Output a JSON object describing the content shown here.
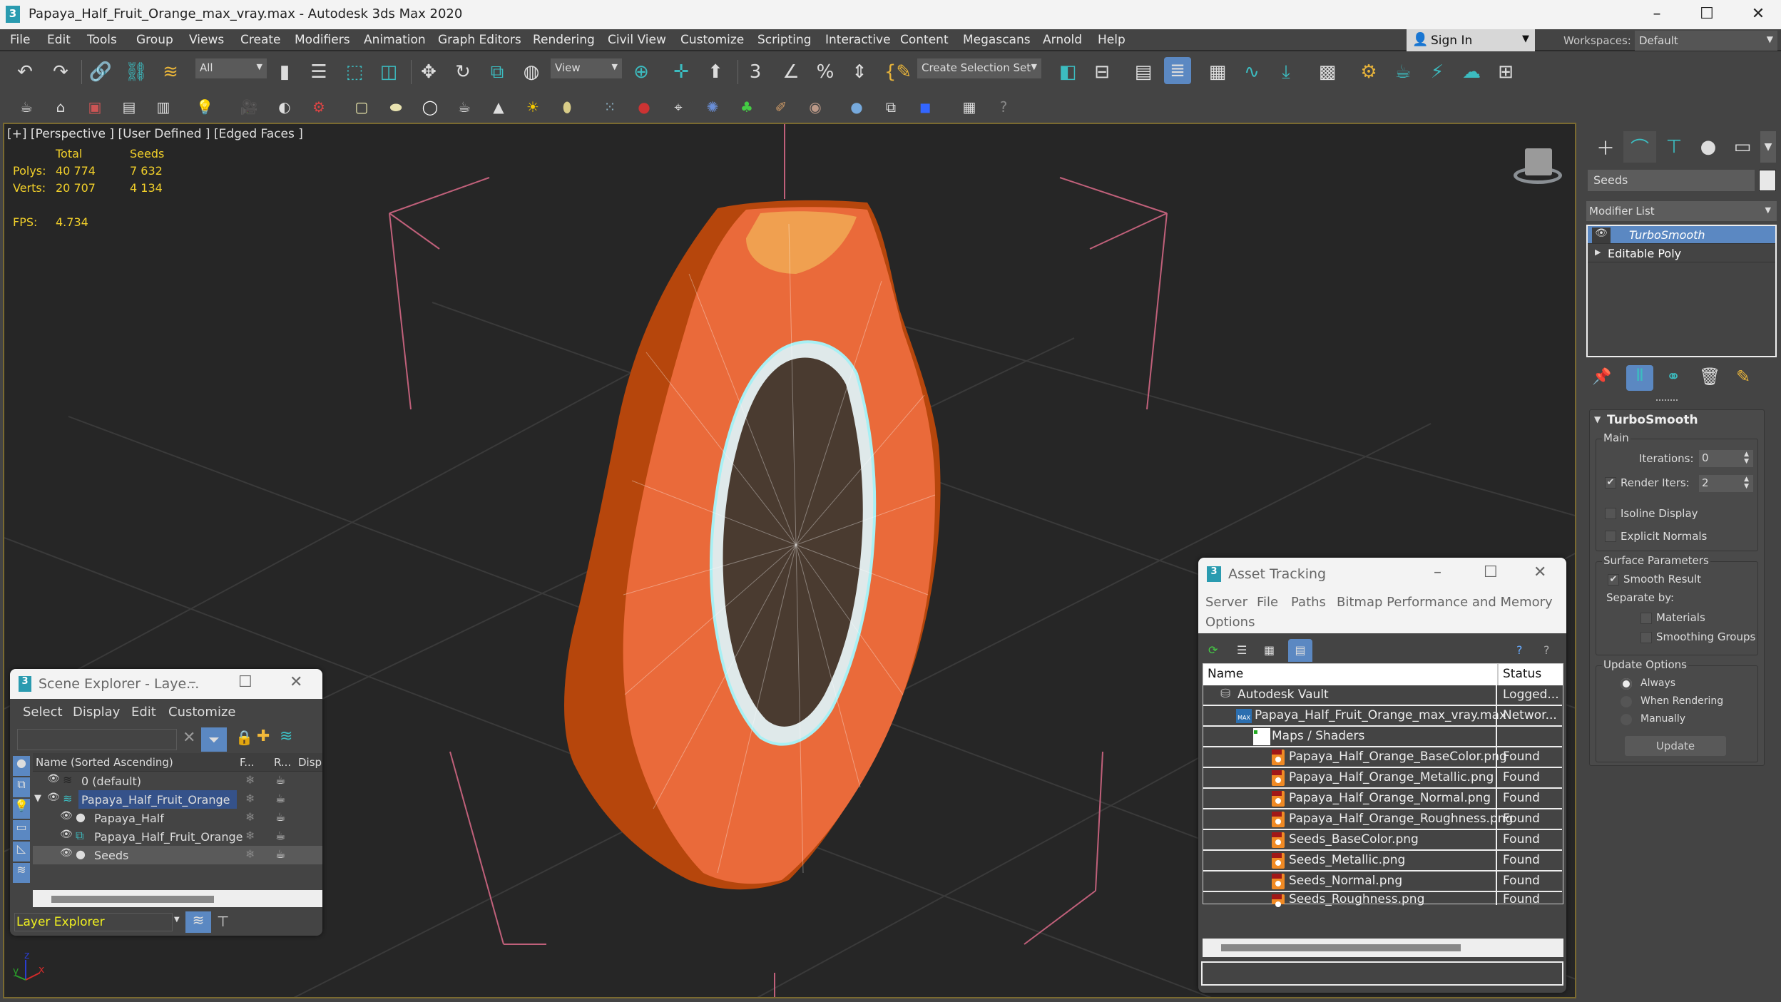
{
  "window": {
    "title": "Papaya_Half_Fruit_Orange_max_vray.max - Autodesk 3ds Max 2020",
    "app_icon": "3",
    "minimize_icon": "–",
    "maximize_icon": "☐",
    "close_icon": "✕"
  },
  "menubar": {
    "items": [
      "File",
      "Edit",
      "Tools",
      "Group",
      "Views",
      "Create",
      "Modifiers",
      "Animation",
      "Graph Editors",
      "Rendering",
      "Civil View",
      "Customize",
      "Scripting",
      "Interactive",
      "Content",
      "Megascans",
      "Arnold",
      "Help"
    ],
    "sign_in": "Sign In",
    "workspaces_label": "Workspaces:",
    "workspace_value": "Default"
  },
  "toolbar": {
    "selection_filter": "All",
    "reference_coord": "View",
    "selection_set": "Create Selection Set"
  },
  "viewport": {
    "label": "[+] [Perspective ] [User Defined ] [Edged Faces ]",
    "stats": {
      "col_total": "Total",
      "col_selected": "Seeds",
      "polys_label": "Polys:",
      "polys_total": "40 774",
      "polys_selected": "7 632",
      "verts_label": "Verts:",
      "verts_total": "20 707",
      "verts_selected": "4 134",
      "fps_label": "FPS:",
      "fps_value": "4.734"
    },
    "axis": {
      "x": "x",
      "y": "y",
      "z": "z"
    }
  },
  "command_panel": {
    "object_name": "Seeds",
    "modifier_list": "Modifier List",
    "stack": [
      {
        "label": "TurboSmooth",
        "selected": true
      },
      {
        "label": "Editable Poly",
        "selected": false
      }
    ],
    "turbosmooth": {
      "title": "TurboSmooth",
      "main_group": "Main",
      "iterations_label": "Iterations:",
      "iterations_value": "0",
      "render_iters_label": "Render Iters:",
      "render_iters_value": "2",
      "render_iters_checked": true,
      "isoline_label": "Isoline Display",
      "isoline_checked": false,
      "explicit_normals_label": "Explicit Normals",
      "explicit_normals_checked": false,
      "surface_group": "Surface Parameters",
      "smooth_result_label": "Smooth Result",
      "smooth_result_checked": true,
      "separate_by_label": "Separate by:",
      "materials_label": "Materials",
      "smoothing_groups_label": "Smoothing Groups",
      "update_group": "Update Options",
      "update_options": [
        "Always",
        "When Rendering",
        "Manually"
      ],
      "update_selected": "Always",
      "update_button": "Update"
    }
  },
  "scene_explorer": {
    "title": "Scene Explorer - Laye...",
    "menu": [
      "Select",
      "Display",
      "Edit",
      "Customize"
    ],
    "search_placeholder": "",
    "columns": [
      "Name (Sorted Ascending)",
      "F...",
      "R...",
      "Displ"
    ],
    "rows": [
      {
        "name": "0 (default)",
        "type": "layer",
        "level": 0
      },
      {
        "name": "Papaya_Half_Fruit_Orange",
        "type": "layer-active",
        "level": 0
      },
      {
        "name": "Papaya_Half",
        "type": "object",
        "level": 1
      },
      {
        "name": "Papaya_Half_Fruit_Orange",
        "type": "group",
        "level": 1
      },
      {
        "name": "Seeds",
        "type": "object",
        "level": 1
      }
    ],
    "explorer_type": "Layer Explorer"
  },
  "asset_tracking": {
    "title": "Asset Tracking",
    "menu": [
      "Server",
      "File",
      "Paths",
      "Bitmap Performance and Memory",
      "Options"
    ],
    "columns": [
      "Name",
      "Status"
    ],
    "rows": [
      {
        "name": "Autodesk Vault",
        "status": "Logged...",
        "icon": "vault",
        "level": 0
      },
      {
        "name": "Papaya_Half_Fruit_Orange_max_vray.max",
        "status": "Networ...",
        "icon": "max-file",
        "level": 1
      },
      {
        "name": "Maps / Shaders",
        "status": "",
        "icon": "maps",
        "level": 2
      },
      {
        "name": "Papaya_Half_Orange_BaseColor.png",
        "status": "Found",
        "icon": "png",
        "level": 3
      },
      {
        "name": "Papaya_Half_Orange_Metallic.png",
        "status": "Found",
        "icon": "png",
        "level": 3
      },
      {
        "name": "Papaya_Half_Orange_Normal.png",
        "status": "Found",
        "icon": "png",
        "level": 3
      },
      {
        "name": "Papaya_Half_Orange_Roughness.png",
        "status": "Found",
        "icon": "png",
        "level": 3
      },
      {
        "name": "Seeds_BaseColor.png",
        "status": "Found",
        "icon": "png",
        "level": 3
      },
      {
        "name": "Seeds_Metallic.png",
        "status": "Found",
        "icon": "png",
        "level": 3
      },
      {
        "name": "Seeds_Normal.png",
        "status": "Found",
        "icon": "png",
        "level": 3
      },
      {
        "name": "Seeds_Roughness.png",
        "status": "Found",
        "icon": "png",
        "level": 3
      }
    ]
  },
  "colors": {
    "accent": "#5b88c2",
    "teal": "#3cbcc0",
    "stats_yellow": "#f2d02a",
    "viewport_border": "#7a6a30"
  }
}
